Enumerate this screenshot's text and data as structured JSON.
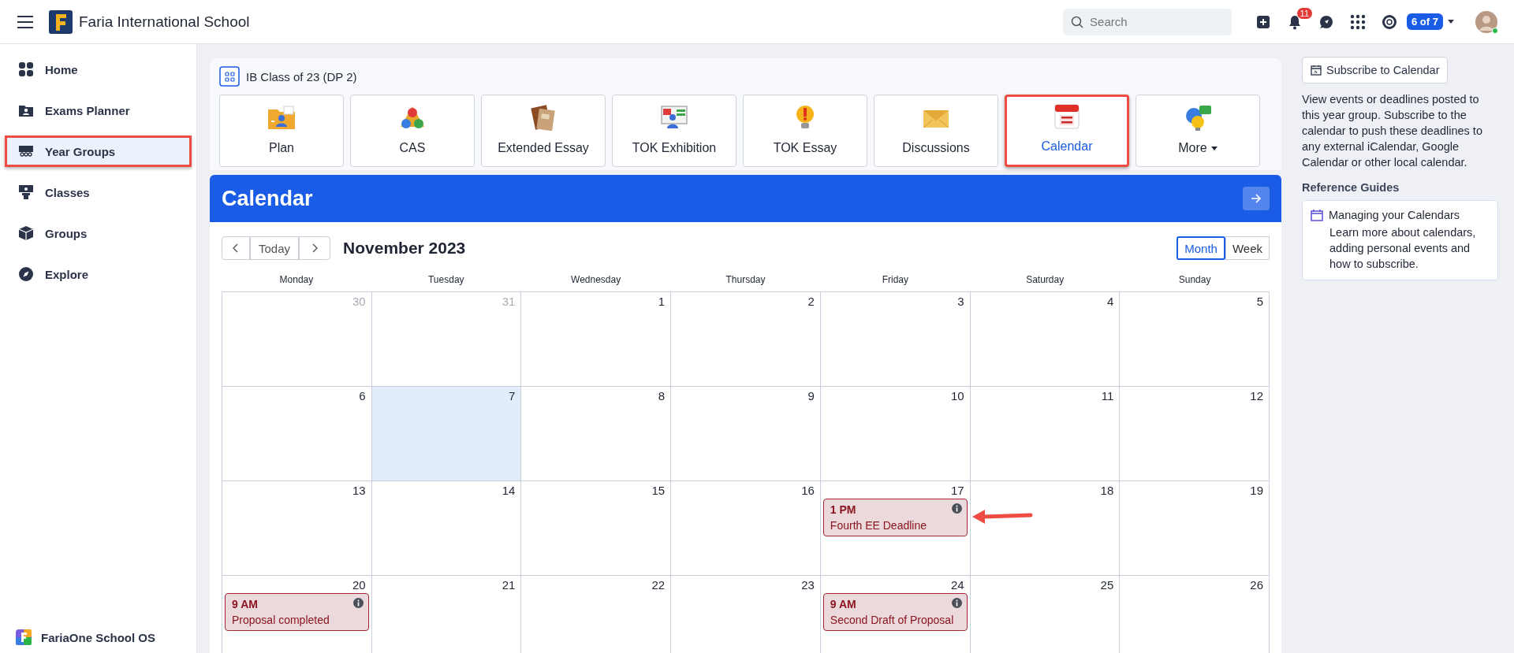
{
  "topbar": {
    "school": "Faria International School",
    "search": {
      "placeholder": "Search"
    },
    "notifications": "11",
    "switcher": "6 of 7"
  },
  "sidebar": {
    "items": [
      {
        "label": "Home",
        "selected": false,
        "highlighted": false
      },
      {
        "label": "Exams Planner",
        "selected": false,
        "highlighted": false
      },
      {
        "label": "Year Groups",
        "selected": true,
        "highlighted": true
      },
      {
        "label": "Classes",
        "selected": false,
        "highlighted": false
      },
      {
        "label": "Groups",
        "selected": false,
        "highlighted": false
      },
      {
        "label": "Explore",
        "selected": false,
        "highlighted": false
      }
    ],
    "footer": "FariaOne School OS"
  },
  "group": {
    "title": "IB Class of 23 (DP 2)",
    "tiles": [
      {
        "label": "Plan",
        "selected": false,
        "highlighted": false
      },
      {
        "label": "CAS",
        "selected": false,
        "highlighted": false
      },
      {
        "label": "Extended Essay",
        "selected": false,
        "highlighted": false
      },
      {
        "label": "TOK Exhibition",
        "selected": false,
        "highlighted": false
      },
      {
        "label": "TOK Essay",
        "selected": false,
        "highlighted": false
      },
      {
        "label": "Discussions",
        "selected": false,
        "highlighted": false
      },
      {
        "label": "Calendar",
        "selected": true,
        "highlighted": true
      },
      {
        "label": "More",
        "selected": false,
        "highlighted": false,
        "dropdown": true
      }
    ]
  },
  "calendar": {
    "title": "Calendar",
    "today_button": "Today",
    "month": "November 2023",
    "views": [
      {
        "label": "Month",
        "selected": true
      },
      {
        "label": "Week",
        "selected": false
      }
    ],
    "weekdays": [
      "Monday",
      "Tuesday",
      "Wednesday",
      "Thursday",
      "Friday",
      "Saturday",
      "Sunday"
    ],
    "weeks": [
      [
        {
          "day": "30",
          "outside": true,
          "today": false
        },
        {
          "day": "31",
          "outside": true,
          "today": false
        },
        {
          "day": "1",
          "outside": false,
          "today": false
        },
        {
          "day": "2",
          "outside": false,
          "today": false
        },
        {
          "day": "3",
          "outside": false,
          "today": false
        },
        {
          "day": "4",
          "outside": false,
          "today": false
        },
        {
          "day": "5",
          "outside": false,
          "today": false
        }
      ],
      [
        {
          "day": "6",
          "outside": false,
          "today": false
        },
        {
          "day": "7",
          "outside": false,
          "today": true
        },
        {
          "day": "8",
          "outside": false,
          "today": false
        },
        {
          "day": "9",
          "outside": false,
          "today": false
        },
        {
          "day": "10",
          "outside": false,
          "today": false
        },
        {
          "day": "11",
          "outside": false,
          "today": false
        },
        {
          "day": "12",
          "outside": false,
          "today": false
        }
      ],
      [
        {
          "day": "13",
          "outside": false,
          "today": false
        },
        {
          "day": "14",
          "outside": false,
          "today": false
        },
        {
          "day": "15",
          "outside": false,
          "today": false
        },
        {
          "day": "16",
          "outside": false,
          "today": false
        },
        {
          "day": "17",
          "outside": false,
          "today": false,
          "events": [
            {
              "time": "1 PM",
              "title": "Fourth EE Deadline",
              "pointed": true
            }
          ]
        },
        {
          "day": "18",
          "outside": false,
          "today": false
        },
        {
          "day": "19",
          "outside": false,
          "today": false
        }
      ],
      [
        {
          "day": "20",
          "outside": false,
          "today": false,
          "events": [
            {
              "time": "9 AM",
              "title": "Proposal completed"
            }
          ]
        },
        {
          "day": "21",
          "outside": false,
          "today": false
        },
        {
          "day": "22",
          "outside": false,
          "today": false
        },
        {
          "day": "23",
          "outside": false,
          "today": false
        },
        {
          "day": "24",
          "outside": false,
          "today": false,
          "events": [
            {
              "time": "9 AM",
              "title": "Second Draft of Proposal"
            }
          ]
        },
        {
          "day": "25",
          "outside": false,
          "today": false
        },
        {
          "day": "26",
          "outside": false,
          "today": false
        }
      ]
    ]
  },
  "side_panel": {
    "subscribe": "Subscribe to Calendar",
    "description": "View events or deadlines posted to this year group. Subscribe to the calendar to push these deadlines to any external iCalendar, Google Calendar or other local calendar.",
    "guides_heading": "Reference Guides",
    "guides": [
      {
        "title": "Managing your Calendars",
        "text": "Learn more about calendars, adding personal events and how to subscribe."
      }
    ]
  }
}
